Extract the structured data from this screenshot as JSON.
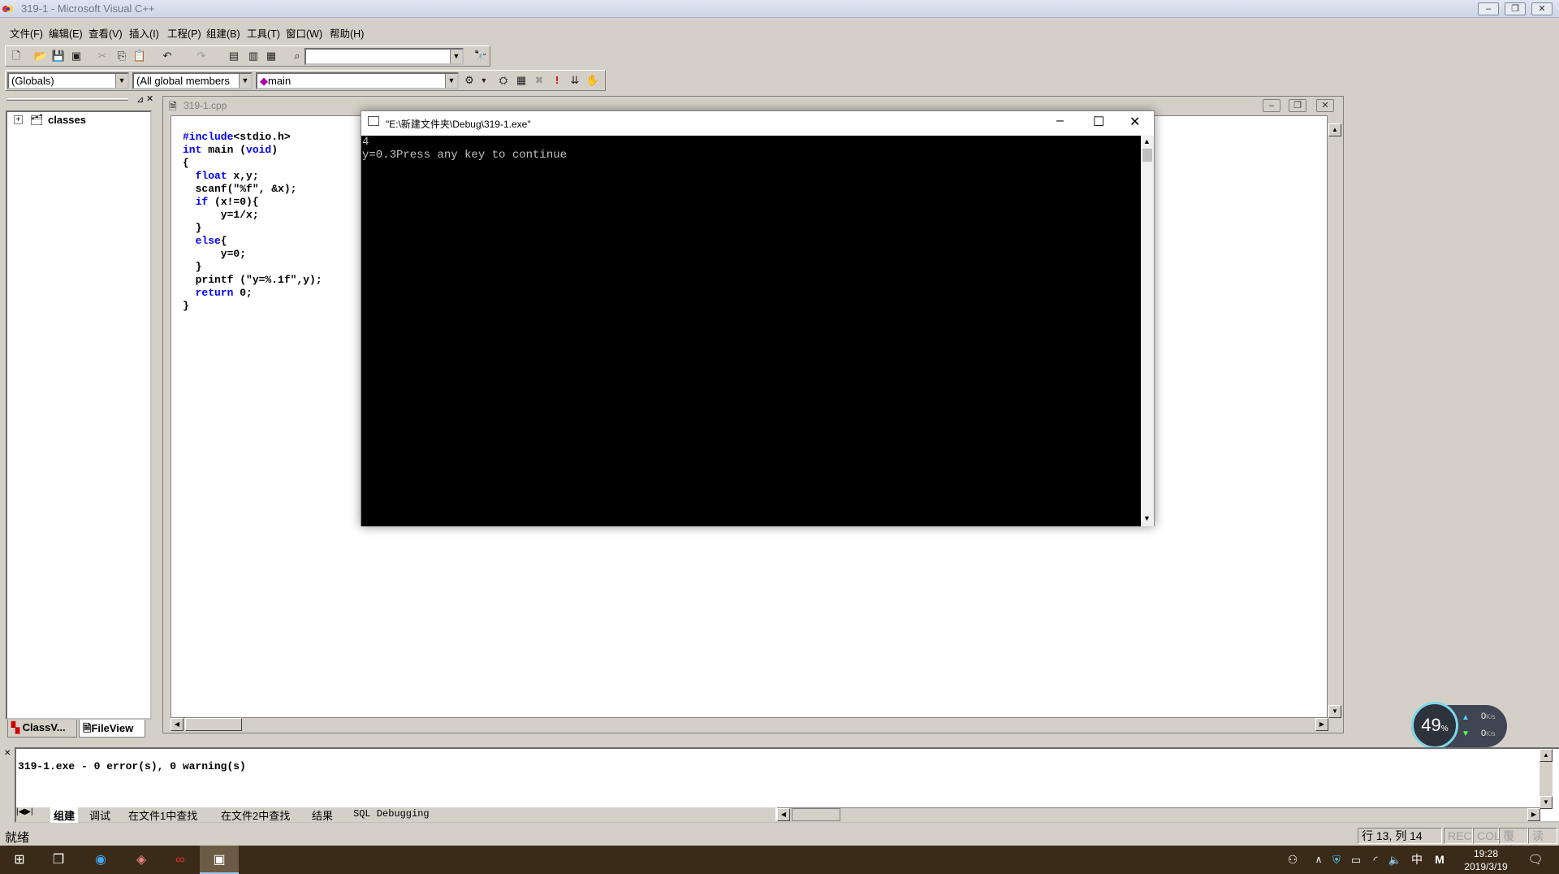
{
  "window": {
    "title": "319-1 - Microsoft Visual C++"
  },
  "menu": [
    "文件(F)",
    "编辑(E)",
    "查看(V)",
    "插入(I)",
    "工程(P)",
    "组建(B)",
    "工具(T)",
    "窗口(W)",
    "帮助(H)"
  ],
  "toolbar": {
    "scope_combo": "(Globals)",
    "members_combo": "(All global members",
    "function_combo": "main",
    "search_combo": ""
  },
  "workspace": {
    "tree_root": "classes",
    "tabs": [
      "ClassV...",
      "FileView"
    ]
  },
  "editor": {
    "file_title": "319-1.cpp",
    "code_lines": [
      "#include<stdio.h>",
      "int main (void)",
      "{",
      "  float x,y;",
      "",
      "  scanf(\"%f\", &x);",
      "  if (x!=0){",
      "      y=1/x;",
      "  }",
      "  else{",
      "      y=0;",
      "  }",
      "  printf (\"y=%.1f\",y);",
      "  return 0;",
      "",
      "",
      "}"
    ]
  },
  "console": {
    "title": "\"E:\\新建文件夹\\Debug\\319-1.exe\"",
    "lines": [
      "4",
      "y=0.3Press any key to continue"
    ]
  },
  "output": {
    "message": "319-1.exe - 0 error(s), 0 warning(s)",
    "tabs": [
      "组建",
      "调试",
      "在文件1中查找",
      "在文件2中查找",
      "结果",
      "SQL Debugging"
    ]
  },
  "status": {
    "left": "就绪",
    "position": "行 13, 列 14",
    "indicators": [
      "REC",
      "COL",
      "覆盖",
      "读取"
    ]
  },
  "net_widget": {
    "percent": "49",
    "percent_unit": "%",
    "up": "0",
    "down": "0",
    "unit": "K/s"
  },
  "taskbar": {
    "time": "19:28",
    "date": "2019/3/19",
    "ime_lang": "中",
    "ime_mode": "M"
  }
}
